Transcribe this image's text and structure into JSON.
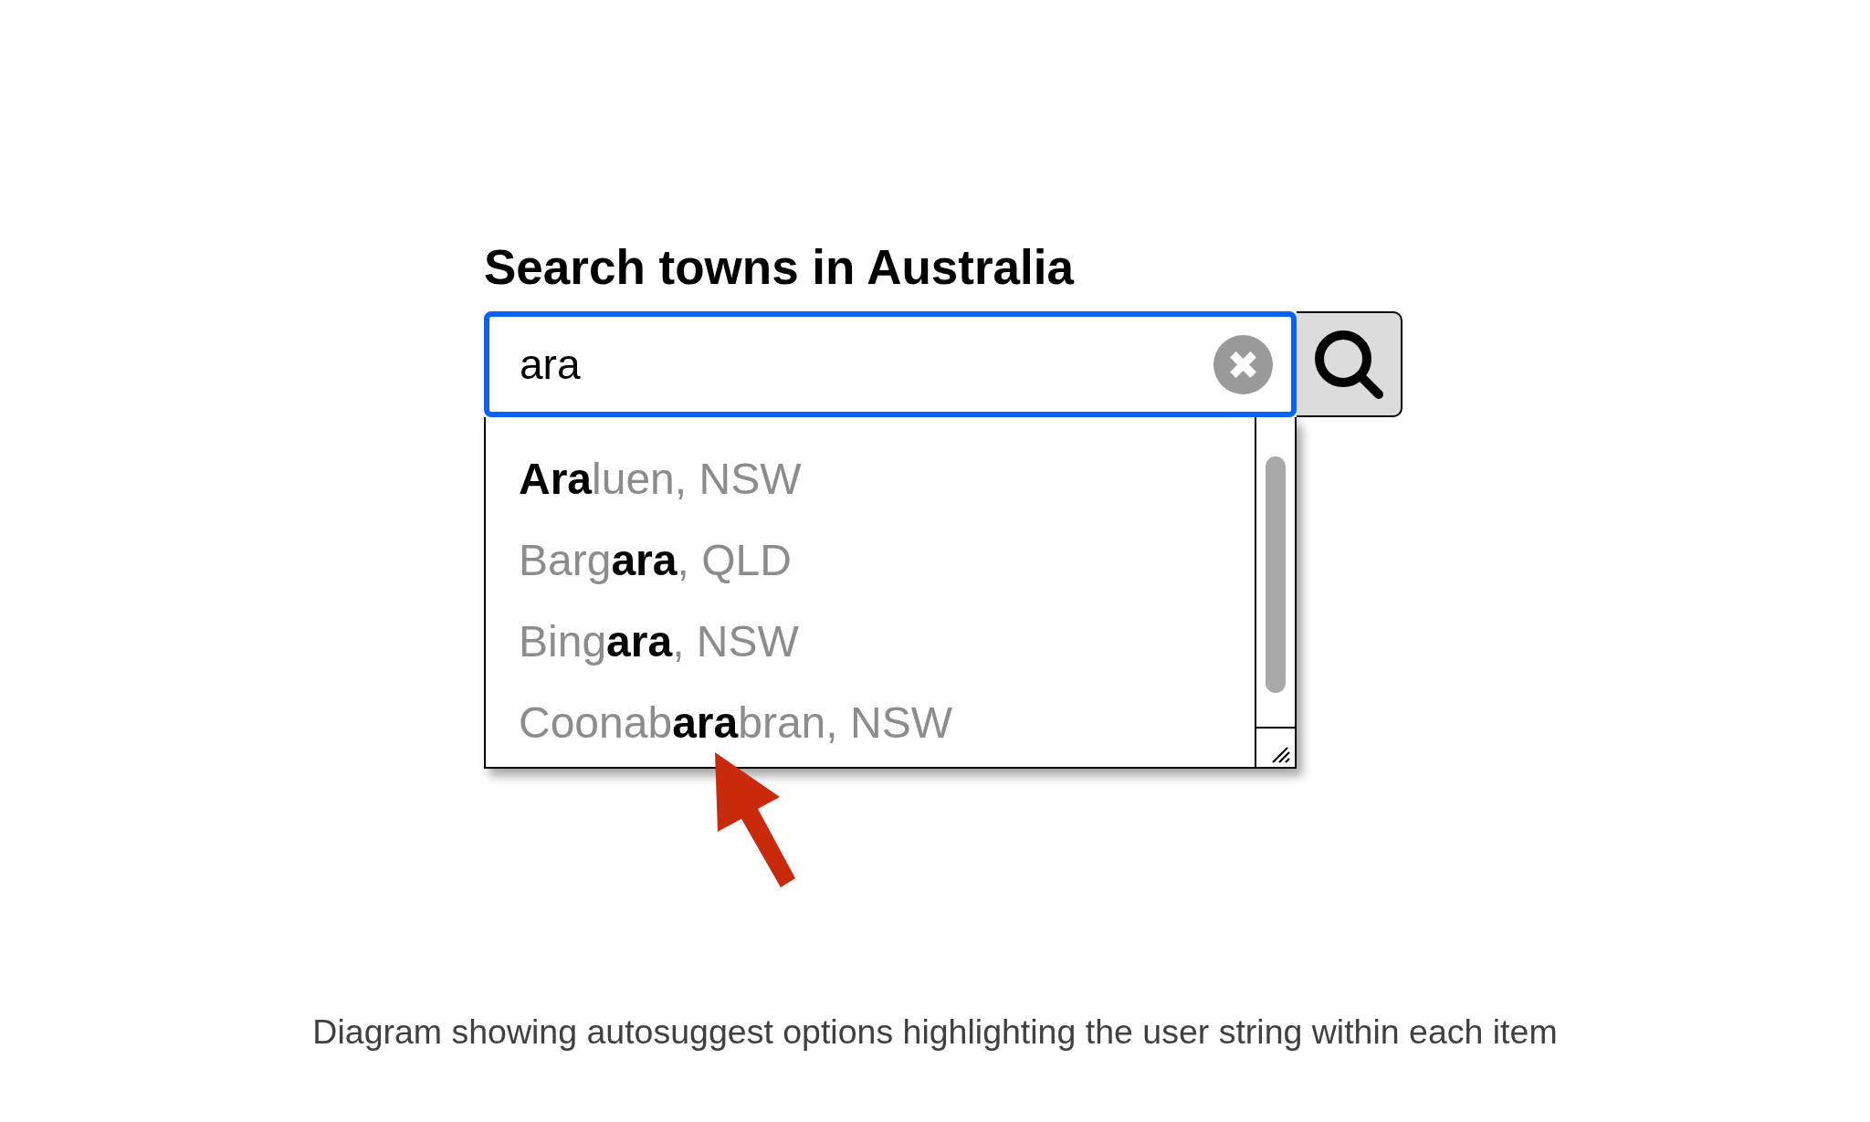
{
  "heading": "Search towns in Australia",
  "search": {
    "value": "ara",
    "focused": true
  },
  "suggestions": [
    {
      "text": "**Ara**luen, NSW",
      "selected": false
    },
    {
      "text": "Barg**ara**, QLD",
      "selected": false
    },
    {
      "text": "Bing**ara**, NSW",
      "selected": false
    },
    {
      "text": "Coonab**ara**bran, NSW",
      "selected": false
    }
  ],
  "caption": "Diagram showing autosuggest options highlighting the user string within each item"
}
